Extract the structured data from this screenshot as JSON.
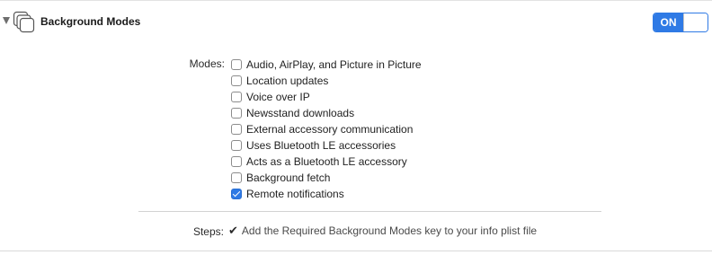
{
  "capability": {
    "title": "Background Modes",
    "icon": "background-modes-icon",
    "toggle_label": "ON",
    "toggle_state": "on",
    "expanded": true
  },
  "modes": {
    "label": "Modes:",
    "items": [
      {
        "label": "Audio, AirPlay, and Picture in Picture",
        "checked": false
      },
      {
        "label": "Location updates",
        "checked": false
      },
      {
        "label": "Voice over IP",
        "checked": false
      },
      {
        "label": "Newsstand downloads",
        "checked": false
      },
      {
        "label": "External accessory communication",
        "checked": false
      },
      {
        "label": "Uses Bluetooth LE accessories",
        "checked": false
      },
      {
        "label": "Acts as a Bluetooth LE accessory",
        "checked": false
      },
      {
        "label": "Background fetch",
        "checked": false
      },
      {
        "label": "Remote notifications",
        "checked": true
      }
    ]
  },
  "steps": {
    "label": "Steps:",
    "items": [
      {
        "check": "✔",
        "text": "Add the Required Background Modes key to your info plist file"
      }
    ]
  },
  "colors": {
    "accent": "#2f7ae5",
    "divider": "#d2d2d2"
  }
}
